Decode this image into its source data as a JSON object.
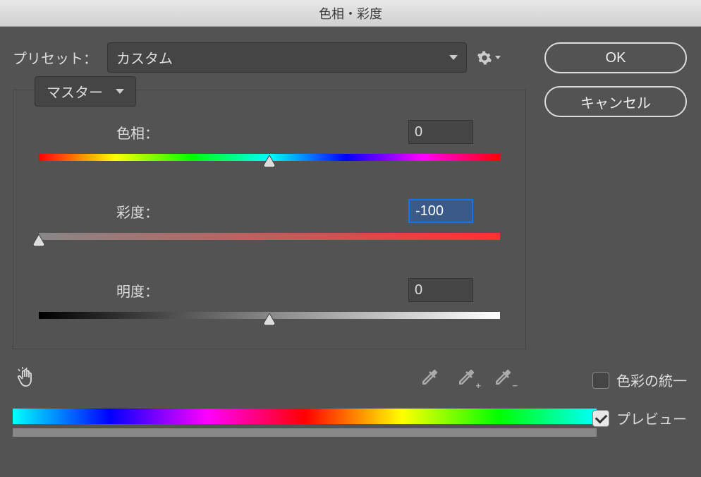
{
  "title": "色相・彩度",
  "preset": {
    "label": "プリセット：",
    "value": "カスタム"
  },
  "buttons": {
    "ok": "OK",
    "cancel": "キャンセル"
  },
  "range": {
    "value": "マスター"
  },
  "sliders": {
    "hue": {
      "label": "色相：",
      "value": "0",
      "pos": 50
    },
    "saturation": {
      "label": "彩度：",
      "value": "-100",
      "pos": 0,
      "active": true
    },
    "lightness": {
      "label": "明度：",
      "value": "0",
      "pos": 50
    }
  },
  "checkboxes": {
    "colorize": {
      "label": "色彩の統一",
      "checked": false
    },
    "preview": {
      "label": "プレビュー",
      "checked": true
    }
  }
}
